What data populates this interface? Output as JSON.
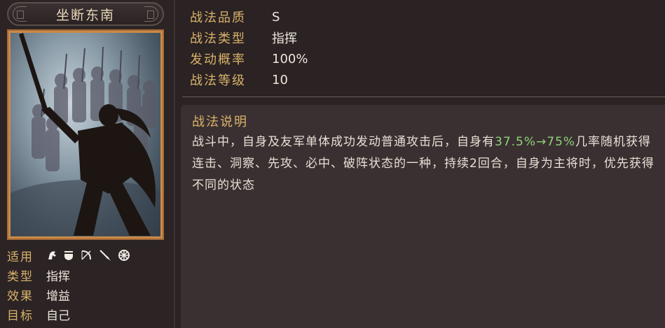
{
  "skill": {
    "name": "坐断东南"
  },
  "left_attributes": {
    "applicable_label": "适用",
    "applicable_icons": [
      "cavalry-icon",
      "shield-infantry-icon",
      "bow-icon",
      "spear-icon",
      "siege-wheel-icon"
    ],
    "type_label": "类型",
    "type_value": "指挥",
    "effect_label": "效果",
    "effect_value": "增益",
    "target_label": "目标",
    "target_value": "自己"
  },
  "stats": [
    {
      "label": "战法品质",
      "value": "S"
    },
    {
      "label": "战法类型",
      "value": "指挥"
    },
    {
      "label": "发动概率",
      "value": "100%"
    },
    {
      "label": "战法等级",
      "value": "10"
    }
  ],
  "description": {
    "title": "战法说明",
    "text_before": "战斗中，自身及友军单体成功发动普通攻击后，自身有",
    "highlight": "37.5%→75%",
    "text_after": "几率随机获得连击、洞察、先攻、必中、破阵状态的一种，持续2回合，自身为主将时，优先获得不同的状态"
  },
  "colors": {
    "label_gold": "#d9b36a",
    "highlight_green": "#8fd27a",
    "card_border": "#a86a36",
    "background": "#2a2223"
  }
}
